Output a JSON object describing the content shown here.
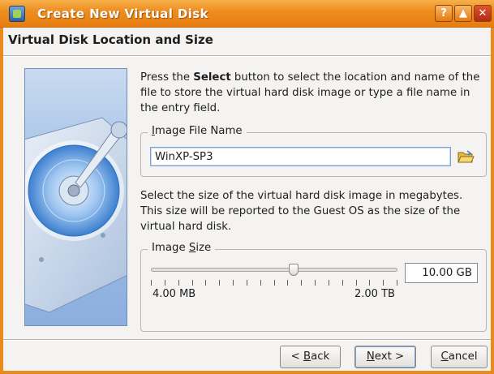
{
  "window": {
    "title": "Create New Virtual Disk",
    "help_glyph": "?",
    "shade_glyph": "▲",
    "close_glyph": "✕"
  },
  "page": {
    "header": "Virtual Disk Location and Size"
  },
  "location": {
    "intro_prefix": "Press the ",
    "intro_bold": "Select",
    "intro_suffix": " button to select the location and name of the file to store the virtual hard disk image or type a file name in the entry field.",
    "group_label_prefix": "",
    "group_label_mnemonic": "I",
    "group_label_rest": "mage File Name",
    "file_value": "WinXP-SP3",
    "folder_icon": "folder-open-icon"
  },
  "size": {
    "intro": "Select the size of the virtual hard disk image in megabytes. This size will be reported to the Guest OS as the size of the virtual hard disk.",
    "group_label_prefix": "Image ",
    "group_label_mnemonic": "S",
    "group_label_rest": "ize",
    "min_label": "4.00 MB",
    "max_label": "2.00 TB",
    "value": "10.00 GB",
    "slider_position": 0.58,
    "tick_count": 19
  },
  "buttons": {
    "back": {
      "prefix": "< ",
      "mnemonic": "B",
      "rest": "ack"
    },
    "next": {
      "prefix": "",
      "mnemonic": "N",
      "rest": "ext >"
    },
    "cancel": {
      "prefix": "",
      "mnemonic": "C",
      "rest": "ancel"
    }
  },
  "colors": {
    "titlebar_accent": "#ee8e20",
    "focus_blue": "#7fa2cf"
  }
}
